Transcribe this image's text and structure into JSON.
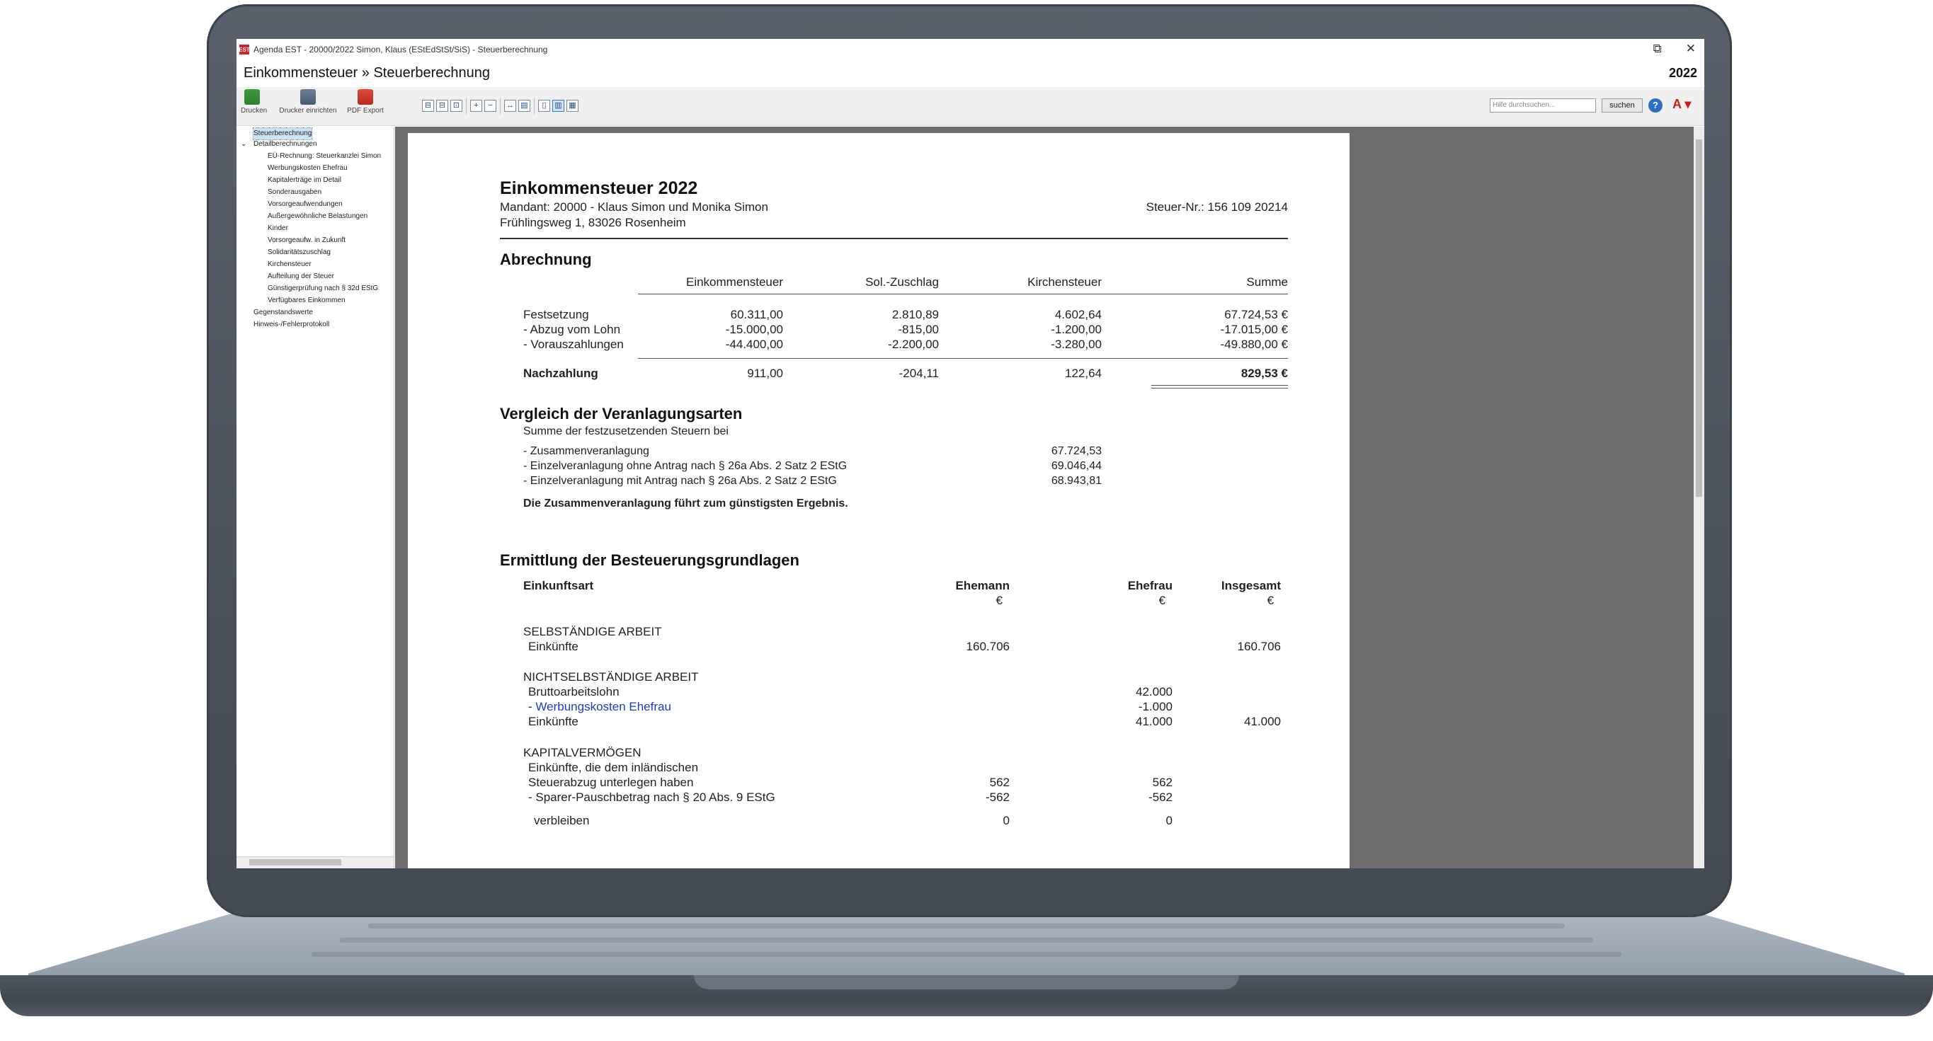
{
  "window": {
    "icon_text": "EST",
    "title": "Agenda EST - 20000/2022 Simon, Klaus (EStEdStSt/SiS) - Steuerberechnung",
    "breadcrumb_parent": "Einkommensteuer",
    "breadcrumb_sep": "»",
    "breadcrumb_current": "Steuerberechnung",
    "year": "2022"
  },
  "toolbar": {
    "print_label": "Drucken",
    "printer_setup_label": "Drucker einrichten",
    "pdf_label": "PDF Export",
    "search_placeholder": "Hilfe durchsuchen...",
    "search_button": "suchen"
  },
  "nav": {
    "items": [
      "Steuerberechnung",
      "Detailberechnungen",
      "EÜ-Rechnung: Steuerkanzlei Simon",
      "Werbungskosten Ehefrau",
      "Kapitalerträge im Detail",
      "Sonderausgaben",
      "Vorsorgeaufwendungen",
      "Außergewöhnliche Belastungen",
      "Kinder",
      "Vorsorgeaufw. in Zukunft",
      "Solidaritätszuschlag",
      "Kirchensteuer",
      "Aufteilung der Steuer",
      "Günstigerprüfung nach § 32d EStG",
      "Verfügbares Einkommen",
      "Gegenstandswerte",
      "Hinweis-/Fehlerprotokoll"
    ]
  },
  "doc": {
    "title": "Einkommensteuer 2022",
    "client": "Mandant: 20000 - Klaus Simon und Monika Simon",
    "address": "Frühlingsweg 1, 83026 Rosenheim",
    "tax_no": "Steuer-Nr.: 156 109 20214",
    "abrechnung": {
      "heading": "Abrechnung",
      "columns": [
        "Einkommensteuer",
        "Sol.-Zuschlag",
        "Kirchensteuer",
        "Summe"
      ],
      "rows": [
        {
          "label": "Festsetzung",
          "values": [
            "60.311,00",
            "2.810,89",
            "4.602,64",
            "67.724,53 €"
          ]
        },
        {
          "label": "- Abzug vom Lohn",
          "values": [
            "-15.000,00",
            "-815,00",
            "-1.200,00",
            "-17.015,00 €"
          ]
        },
        {
          "label": "- Vorauszahlungen",
          "values": [
            "-44.400,00",
            "-2.200,00",
            "-3.280,00",
            "-49.880,00 €"
          ]
        }
      ],
      "total": {
        "label": "Nachzahlung",
        "values": [
          "911,00",
          "-204,11",
          "122,64",
          "829,53 €"
        ]
      }
    },
    "vergleich": {
      "heading": "Vergleich der Veranlagungsarten",
      "intro": "Summe der festzusetzenden Steuern bei",
      "rows": [
        {
          "label": "- Zusammenveranlagung",
          "value": "67.724,53"
        },
        {
          "label": "- Einzelveranlagung ohne Antrag nach § 26a Abs. 2 Satz 2 EStG",
          "value": "69.046,44"
        },
        {
          "label": "- Einzelveranlagung mit Antrag nach § 26a Abs. 2 Satz 2 EStG",
          "value": "68.943,81"
        }
      ],
      "conclusion": "Die Zusammenveranlagung führt zum günstigsten Ergebnis."
    },
    "ermittlung": {
      "heading": "Ermittlung der Besteuerungsgrundlagen",
      "col_label": "Einkunftsart",
      "col_husband": "Ehemann",
      "col_wife": "Ehefrau",
      "col_total": "Insgesamt",
      "currency": "€",
      "selbst_heading": "SELBSTÄNDIGE ARBEIT",
      "selbst_label": "Einkünfte",
      "selbst_husband": "160.706",
      "selbst_total": "160.706",
      "nichtselbst_heading": "NICHTSELBSTÄNDIGE ARBEIT",
      "brutto_label": "Bruttoarbeitslohn",
      "brutto_wife": "42.000",
      "wk_prefix": "-",
      "wk_label": "Werbungskosten Ehefrau",
      "wk_wife": "-1.000",
      "ek2_label": "Einkünfte",
      "ek2_wife": "41.000",
      "ek2_total": "41.000",
      "kapital_heading": "KAPITALVERMÖGEN",
      "kap_line1": "Einkünfte, die dem inländischen",
      "kap_line2": "Steuerabzug unterlegen haben",
      "kap_val_husband": "562",
      "kap_val_wife": "562",
      "sparer_label": "- Sparer-Pauschbetrag nach § 20 Abs. 9 EStG",
      "sparer_husband": "-562",
      "sparer_wife": "-562",
      "verbleiben_label": "verbleiben",
      "verbleiben_husband": "0",
      "verbleiben_wife": "0"
    }
  }
}
